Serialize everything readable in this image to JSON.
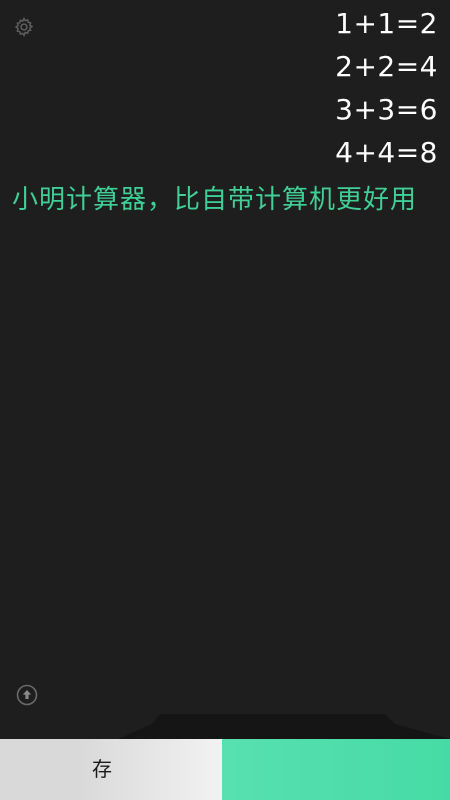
{
  "history": [
    "1+1=2",
    "2+2=4",
    "3+3=6",
    "4+4=8"
  ],
  "message": "小明计算器，比自带计算机更好用",
  "bottom_bar": {
    "left_label": "存"
  },
  "colors": {
    "background": "#1e1e1e",
    "message_text": "#3fcf97",
    "accent": "#46dba6"
  },
  "icons": {
    "settings": "gear-icon",
    "scroll_top": "arrow-up-circle-icon"
  }
}
